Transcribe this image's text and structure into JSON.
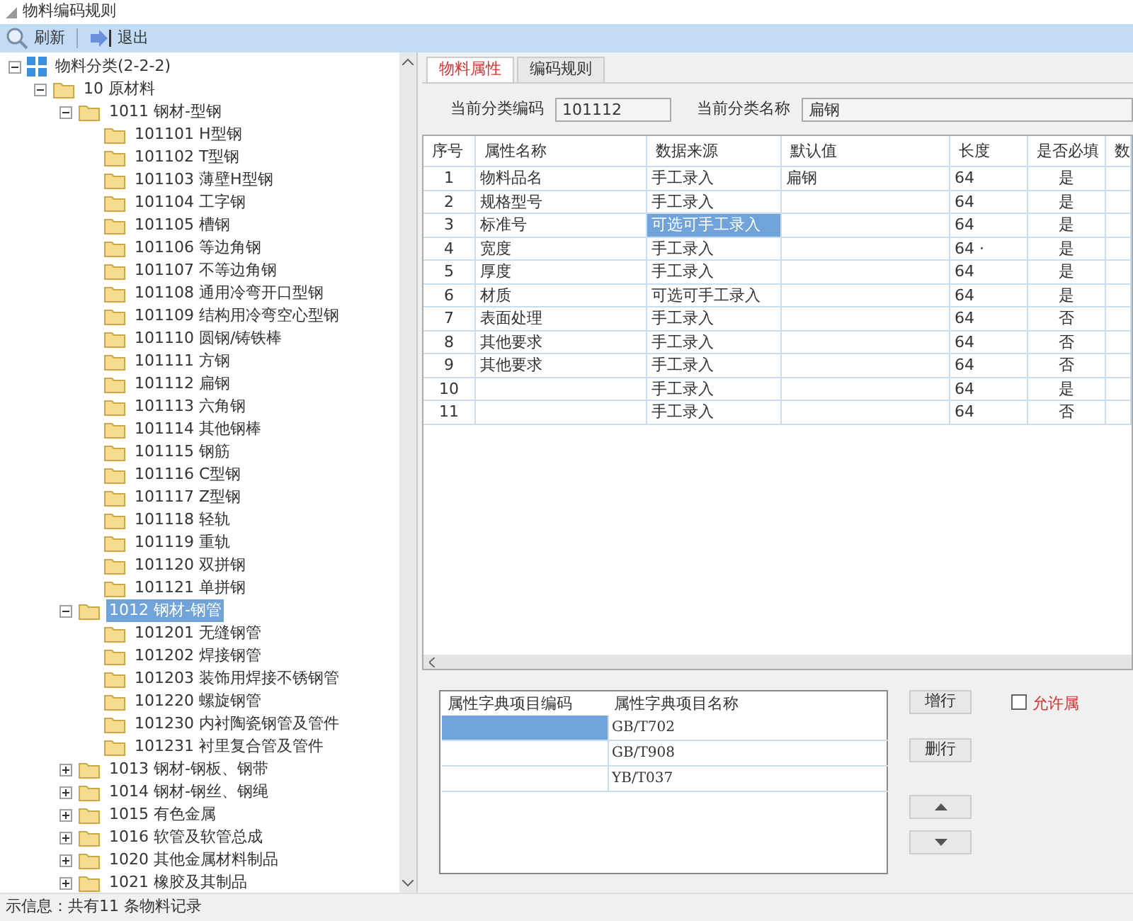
{
  "window": {
    "title": "物料编码规则"
  },
  "toolbar": [
    {
      "label": "刷新",
      "kind": "search"
    },
    {
      "label": "退出",
      "kind": "exit"
    }
  ],
  "tree": [
    {
      "label": "物料分类(2-2-2)",
      "kind": "root",
      "expanded": true,
      "selected": false,
      "children": [
        {
          "label": "10 原材料",
          "expanded": true,
          "selected": false,
          "children": [
            {
              "label": "1011 钢材-型钢",
              "expanded": true,
              "selected": false,
              "children": [
                {
                  "label": "101101 H型钢",
                  "selected": false
                },
                {
                  "label": "101102 T型钢",
                  "selected": false
                },
                {
                  "label": "101103 薄壁H型钢",
                  "selected": false
                },
                {
                  "label": "101104 工字钢",
                  "selected": false
                },
                {
                  "label": "101105 槽钢",
                  "selected": false
                },
                {
                  "label": "101106 等边角钢",
                  "selected": false
                },
                {
                  "label": "101107 不等边角钢",
                  "selected": false
                },
                {
                  "label": "101108 通用冷弯开口型钢",
                  "selected": false
                },
                {
                  "label": "101109 结构用冷弯空心型钢",
                  "selected": false
                },
                {
                  "label": "101110 圆钢/铸铁棒",
                  "selected": false
                },
                {
                  "label": "101111 方钢",
                  "selected": false
                },
                {
                  "label": "101112 扁钢",
                  "selected": false
                },
                {
                  "label": "101113 六角钢",
                  "selected": false
                },
                {
                  "label": "101114 其他钢棒",
                  "selected": false
                },
                {
                  "label": "101115 钢筋",
                  "selected": false
                },
                {
                  "label": "101116 C型钢",
                  "selected": false
                },
                {
                  "label": "101117 Z型钢",
                  "selected": false
                },
                {
                  "label": "101118 轻轨",
                  "selected": false
                },
                {
                  "label": "101119 重轨",
                  "selected": false
                },
                {
                  "label": "101120 双拼钢",
                  "selected": false
                },
                {
                  "label": "101121 单拼钢",
                  "selected": false
                }
              ]
            },
            {
              "label": "1012 钢材-钢管",
              "expanded": true,
              "selected": true,
              "children": [
                {
                  "label": "101201 无缝钢管",
                  "selected": false
                },
                {
                  "label": "101202 焊接钢管",
                  "selected": false
                },
                {
                  "label": "101203 装饰用焊接不锈钢管",
                  "selected": false
                },
                {
                  "label": "101220 螺旋钢管",
                  "selected": false
                },
                {
                  "label": "101230 内衬陶瓷钢管及管件",
                  "selected": false
                },
                {
                  "label": "101231 衬里复合管及管件",
                  "selected": false
                }
              ]
            },
            {
              "label": "1013 钢材-钢板、钢带",
              "expanded": false,
              "selected": false
            },
            {
              "label": "1014 钢材-钢丝、钢绳",
              "expanded": false,
              "selected": false
            },
            {
              "label": "1015 有色金属",
              "expanded": false,
              "selected": false
            },
            {
              "label": "1016 软管及软管总成",
              "expanded": false,
              "selected": false
            },
            {
              "label": "1020 其他金属材料制品",
              "expanded": false,
              "selected": false
            },
            {
              "label": "1021 橡胶及其制品",
              "expanded": false,
              "selected": false
            }
          ]
        }
      ]
    }
  ],
  "status_bar": "示信息：共有11 条物料记录",
  "tabs": [
    {
      "label": "物料属性",
      "selected": true
    },
    {
      "label": "编码规则",
      "selected": false
    }
  ],
  "fields": [
    {
      "label": "当前分类编码",
      "value": "101112"
    },
    {
      "label": "当前分类名称",
      "value": "扁钢"
    }
  ],
  "table": {
    "columns": [
      "序号",
      "属性名称",
      "数据来源",
      "默认值",
      "长度",
      "是否必填",
      "数"
    ],
    "rows": [
      {
        "cells": [
          "1",
          "物料品名",
          "手工录入",
          "扁钢",
          "64",
          "是"
        ],
        "selected": false
      },
      {
        "cells": [
          "2",
          "规格型号",
          "手工录入",
          "",
          "64",
          "是"
        ],
        "selected": false
      },
      {
        "cells": [
          "3",
          "标准号",
          "可选可手工录入",
          "",
          "64",
          "是"
        ],
        "selected": true
      },
      {
        "cells": [
          "4",
          "宽度",
          "手工录入",
          "",
          "64 ·",
          "是"
        ],
        "selected": false
      },
      {
        "cells": [
          "5",
          "厚度",
          "手工录入",
          "",
          "64",
          "是"
        ],
        "selected": false
      },
      {
        "cells": [
          "6",
          "材质",
          "可选可手工录入",
          "",
          "64",
          "是"
        ],
        "selected": false
      },
      {
        "cells": [
          "7",
          "表面处理",
          "手工录入",
          "",
          "64",
          "否"
        ],
        "selected": false
      },
      {
        "cells": [
          "8",
          "其他要求",
          "手工录入",
          "",
          "64",
          "否"
        ],
        "selected": false
      },
      {
        "cells": [
          "9",
          "其他要求",
          "手工录入",
          "",
          "64",
          "否"
        ],
        "selected": false
      },
      {
        "cells": [
          "10",
          "",
          "手工录入",
          "",
          "64",
          "是"
        ],
        "selected": false
      },
      {
        "cells": [
          "11",
          "",
          "手工录入",
          "",
          "64",
          "否"
        ],
        "selected": false
      }
    ]
  },
  "dictionary": {
    "columns": [
      "属性字典项目编码",
      "属性字典项目名称"
    ],
    "rows": [
      {
        "code": "",
        "name": "GB/T702",
        "selected": true
      },
      {
        "code": "",
        "name": "GB/T908",
        "selected": false
      },
      {
        "code": "",
        "name": "YB/T037",
        "selected": false
      }
    ]
  },
  "buttons": [
    {
      "label": "增行",
      "kind": "text"
    },
    {
      "label": "删行",
      "kind": "text"
    },
    {
      "kind": "up"
    },
    {
      "kind": "down"
    }
  ],
  "allow_checkbox": {
    "label": "允许属",
    "checked": false
  }
}
